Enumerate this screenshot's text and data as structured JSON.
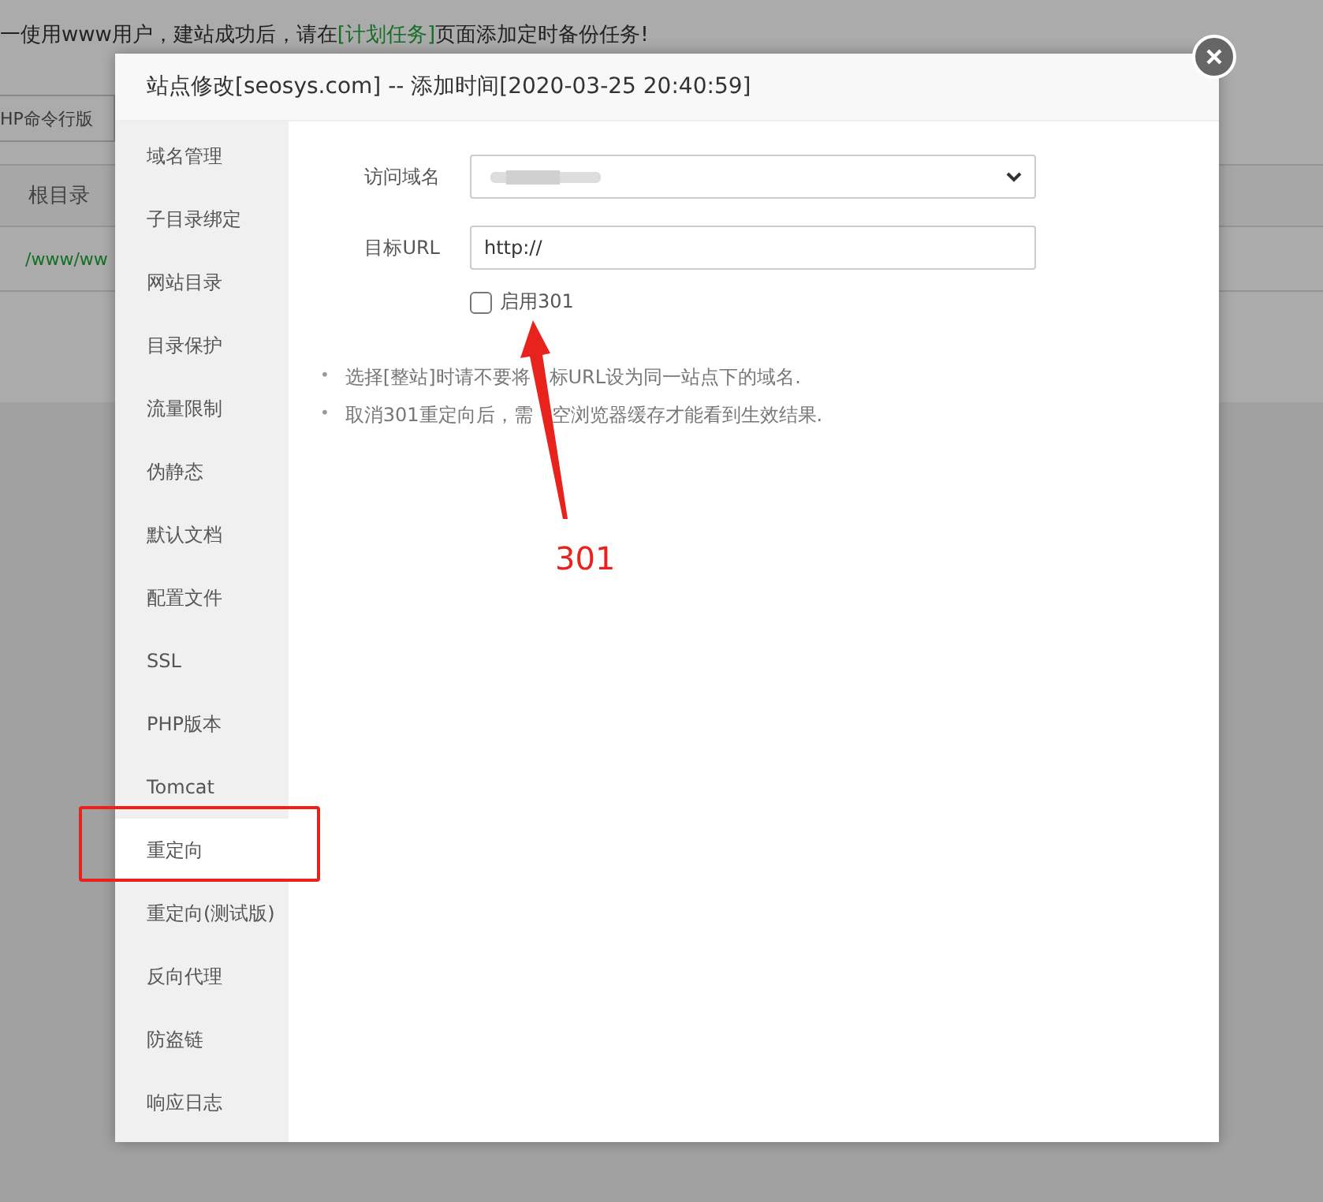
{
  "background_page": {
    "notice": {
      "before": "一使用www用户，建站成功后，请在",
      "link": "[计划任务]",
      "after": "页面添加定时备份任务!"
    },
    "php_cli_label": "HP命令行版",
    "table": {
      "columns": [
        "根目录"
      ],
      "rows": [
        [
          "/www/ww"
        ]
      ]
    }
  },
  "dialog": {
    "title": "站点修改[seosys.com] -- 添加时间[2020-03-25 20:40:59]",
    "sidebar": {
      "items": [
        {
          "label": "域名管理",
          "selected": false
        },
        {
          "label": "子目录绑定",
          "selected": false
        },
        {
          "label": "网站目录",
          "selected": false
        },
        {
          "label": "目录保护",
          "selected": false
        },
        {
          "label": "流量限制",
          "selected": false
        },
        {
          "label": "伪静态",
          "selected": false
        },
        {
          "label": "默认文档",
          "selected": false
        },
        {
          "label": "配置文件",
          "selected": false
        },
        {
          "label": "SSL",
          "selected": false
        },
        {
          "label": "PHP版本",
          "selected": false
        },
        {
          "label": "Tomcat",
          "selected": false
        },
        {
          "label": "重定向",
          "selected": true
        },
        {
          "label": "重定向(测试版)",
          "selected": false
        },
        {
          "label": "反向代理",
          "selected": false
        },
        {
          "label": "防盗链",
          "selected": false
        },
        {
          "label": "响应日志",
          "selected": false
        }
      ]
    },
    "form": {
      "domain_label": "访问域名",
      "target_label": "目标URL",
      "target_value": "http://",
      "enable_301": {
        "label": "启用301",
        "checked": false
      }
    },
    "tips": [
      {
        "marker": "•",
        "text": "选择[整站]时请不要将　标URL设为同一站点下的域名."
      },
      {
        "marker": "•",
        "text": "取消301重定向后，需　空浏览器缓存才能看到生效结果."
      }
    ]
  },
  "annotation": {
    "text": "301"
  }
}
